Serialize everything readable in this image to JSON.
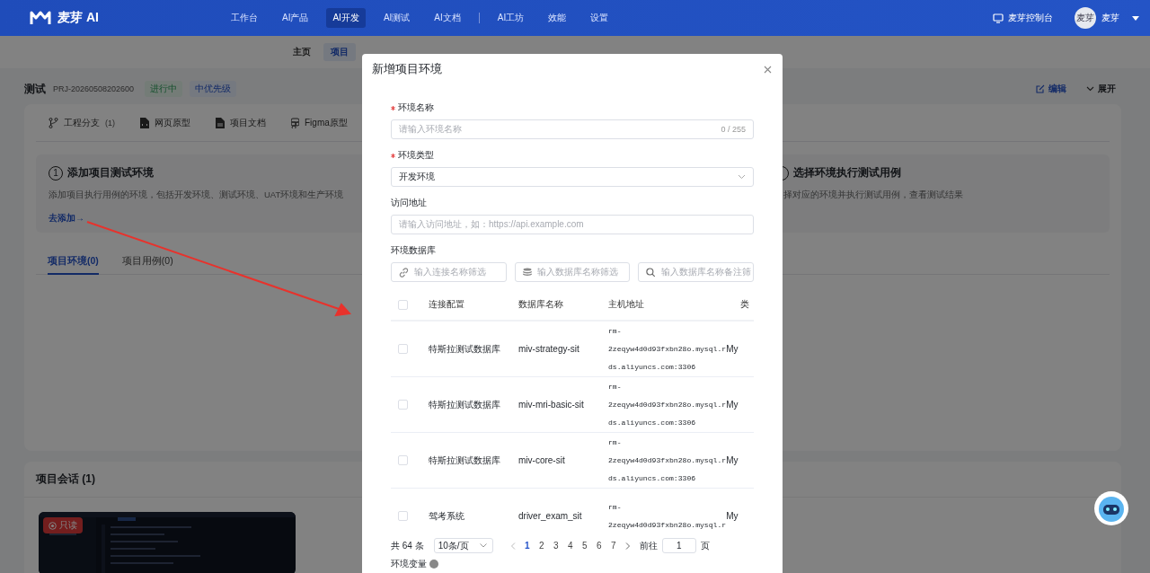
{
  "nav": {
    "logo": "麦芽 AI",
    "items": [
      {
        "label": "工作台",
        "selected": false,
        "separator_before": false
      },
      {
        "label": "AI产品",
        "selected": false,
        "separator_before": false
      },
      {
        "label": "AI开发",
        "selected": true,
        "separator_before": false
      },
      {
        "label": "AI测试",
        "selected": false,
        "separator_before": false
      },
      {
        "label": "AI文档",
        "selected": false,
        "separator_before": false
      },
      {
        "label": "AI工坊",
        "selected": false,
        "separator_before": true
      },
      {
        "label": "效能",
        "selected": false,
        "separator_before": false
      },
      {
        "label": "设置",
        "selected": false,
        "separator_before": false
      }
    ],
    "console": "麦芽控制台",
    "avatar": "麦芽",
    "user": "麦芽"
  },
  "subnav": [
    {
      "label": "主页",
      "selected": false
    },
    {
      "label": "项目",
      "selected": true
    }
  ],
  "project": {
    "name": "测试",
    "code": "PRJ-20260508202600",
    "tags": [
      {
        "label": "进行中",
        "kind": "success"
      },
      {
        "label": "中优先级",
        "kind": "info"
      }
    ],
    "edit": "编辑",
    "expand": "展开"
  },
  "resource_tabs": [
    {
      "kind": "branch",
      "label": "工程分支",
      "count": "(1)"
    },
    {
      "kind": "webpage",
      "label": "网页原型"
    },
    {
      "kind": "document",
      "label": "项目文档"
    },
    {
      "kind": "figma",
      "label": "Figma原型"
    }
  ],
  "steps": [
    {
      "number": "1",
      "title": "添加项目测试环境",
      "desc": "添加项目执行用例的环境，包括开发环境、测试环境、UAT环境和生产环境",
      "link": "去添加→"
    },
    {
      "title": "选择环境执行测试用例",
      "desc": "择对应的环境并执行测试用例，查看测试结果"
    }
  ],
  "tabs": [
    {
      "label": "项目环境(0)",
      "selected": true
    },
    {
      "label": "项目用例(0)",
      "selected": false
    }
  ],
  "sessions": {
    "title": "项目会话 (1)",
    "items": [
      {
        "kind": "picture",
        "badge": "只读"
      }
    ]
  },
  "modal": {
    "title": "新增项目环境",
    "fields": [
      {
        "kind": "input",
        "label": "环境名称",
        "required": true,
        "placeholder": "请输入环境名称",
        "counter": "0 / 255"
      },
      {
        "kind": "select",
        "label": "环境类型",
        "required": true,
        "value": "开发环境"
      },
      {
        "kind": "input",
        "label": "访问地址",
        "required": false,
        "placeholder": "请输入访问地址，如：https://api.example.com"
      }
    ],
    "database": {
      "label": "环境数据库",
      "filters": [
        {
          "kind": "link",
          "placeholder": "输入连接名称筛选"
        },
        {
          "kind": "database",
          "placeholder": "输入数据库名称筛选"
        },
        {
          "kind": "search",
          "placeholder": "输入数据库名称备注筛"
        }
      ],
      "all_checked": false,
      "columns": [
        "连接配置",
        "数据库名称",
        "主机地址",
        "类"
      ],
      "rows": [
        {
          "checked": false,
          "connection": "特斯拉测试数据库",
          "database": "miv-strategy-sit",
          "host": "rm-2zeqyw4d0d93fxbn28o.mysql.rds.aliyuncs.com:3306",
          "type": "My"
        },
        {
          "checked": false,
          "connection": "特斯拉测试数据库",
          "database": "miv-mri-basic-sit",
          "host": "rm-2zeqyw4d0d93fxbn28o.mysql.rds.aliyuncs.com:3306",
          "type": "My"
        },
        {
          "checked": false,
          "connection": "特斯拉测试数据库",
          "database": "miv-core-sit",
          "host": "rm-2zeqyw4d0d93fxbn28o.mysql.rds.aliyuncs.com:3306",
          "type": "My"
        },
        {
          "checked": false,
          "connection": "驾考系统",
          "database": "driver_exam_sit",
          "host": "rm-2zeqyw4d0d93fxbn28o.mysql.r",
          "type": "My"
        }
      ],
      "pagination": {
        "total": "共 64 条",
        "page_size": "10条/页",
        "pages": [
          {
            "label": "1",
            "selected": true
          },
          {
            "label": "2",
            "selected": false
          },
          {
            "label": "3",
            "selected": false
          },
          {
            "label": "4",
            "selected": false
          },
          {
            "label": "5",
            "selected": false
          },
          {
            "label": "6",
            "selected": false
          },
          {
            "label": "7",
            "selected": false
          }
        ],
        "goto": "前往",
        "goto_value": "1",
        "suffix": "页"
      }
    },
    "next_section": "环境变量"
  }
}
